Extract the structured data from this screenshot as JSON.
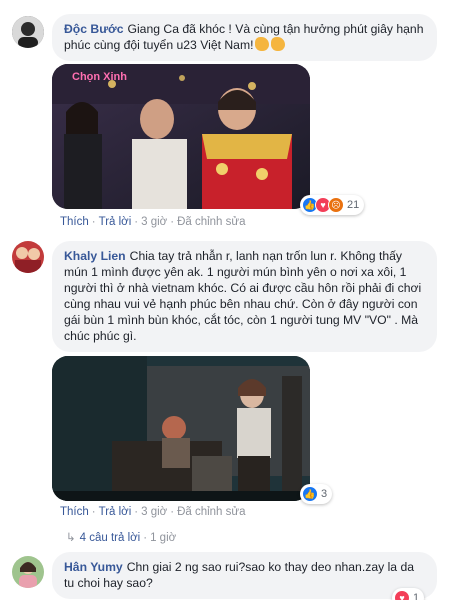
{
  "comments": [
    {
      "author": "Độc Bước",
      "text": "Giang Ca đã khóc ! Và cùng tận hưởng phút giây hạnh phúc cùng đội tuyển u23 Việt Nam!",
      "actions": {
        "like": "Thích",
        "reply": "Trả lời",
        "time": "3 giờ",
        "edited": "Đã chỉnh sửa"
      },
      "reaction_count": "21",
      "reactions": [
        "like-icon",
        "heart-icon",
        "angry-icon"
      ],
      "media_logo": "Chọn Xinh"
    },
    {
      "author": "Khaly Lien",
      "text": "Chia tay trả nhẫn r, lanh nạn trốn lun r. Không thấy mún 1 mình được yên ak. 1 người mún bình yên o nơi xa xôi, 1 người thì ở nhà vietnam khóc. Có ai được cầu hôn rồi phải đi chơi cùng nhau vui vẻ hạnh phúc bên nhau chứ. Còn ở đây người con gái bùn 1 mình bùn khóc, cắt tóc, còn 1 người tung MV \"VO\" . Mà chúc phúc gì.",
      "actions": {
        "like": "Thích",
        "reply": "Trả lời",
        "time": "3 giờ",
        "edited": "Đã chỉnh sửa"
      },
      "reaction_count": "3",
      "reactions": [
        "like-icon"
      ],
      "replies": {
        "label": "4 câu trả lời",
        "time": "1 giờ"
      }
    },
    {
      "author": "Hân Yumy",
      "text": "Chn giai 2 ng sao rui?sao ko thay deo nhan.zay la da tu choi hay sao?",
      "reaction_count": "1",
      "reactions": [
        "heart-icon"
      ]
    }
  ],
  "colors": {
    "link": "#385898",
    "bubble": "#f2f3f5",
    "like": "#1877f2",
    "heart": "#f33e58"
  }
}
